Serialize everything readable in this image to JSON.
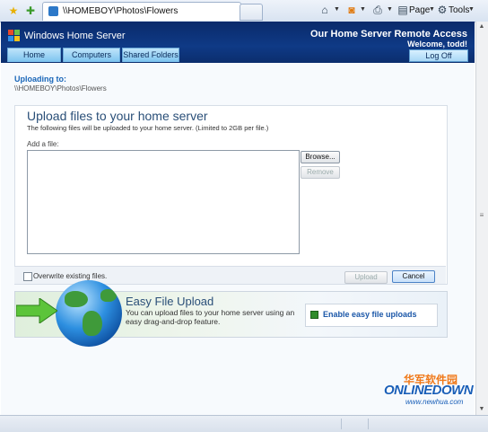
{
  "browser": {
    "tab_title": "\\\\HOMEBOY\\Photos\\Flowers",
    "commands": {
      "page": "Page",
      "tools": "Tools"
    }
  },
  "header": {
    "brand": "Windows Home Server",
    "title": "Our Home Server Remote Access",
    "welcome": "Welcome, todd!",
    "tabs": [
      "Home",
      "Computers",
      "Shared Folders"
    ],
    "logoff": "Log Off"
  },
  "breadcrumb": {
    "label": "Uploading to:",
    "path": "\\\\HOMEBOY\\Photos\\Flowers"
  },
  "upload": {
    "heading": "Upload files to your home server",
    "description": "The following files will be uploaded to your home server. (Limited to 2GB per file.)",
    "add_file_label": "Add a file:",
    "browse": "Browse...",
    "remove": "Remove",
    "overwrite_label": "Overwrite existing files.",
    "overwrite_checked": false,
    "upload_button": "Upload",
    "cancel_button": "Cancel"
  },
  "easy_upload": {
    "heading": "Easy File Upload",
    "description": "You can upload files to your home server using an easy drag-and-drop feature.",
    "enable_link": "Enable easy file uploads"
  },
  "watermark": {
    "cn": "华军软件园",
    "logo": "ONLINEDOWN",
    "url": "www.newhua.com"
  }
}
